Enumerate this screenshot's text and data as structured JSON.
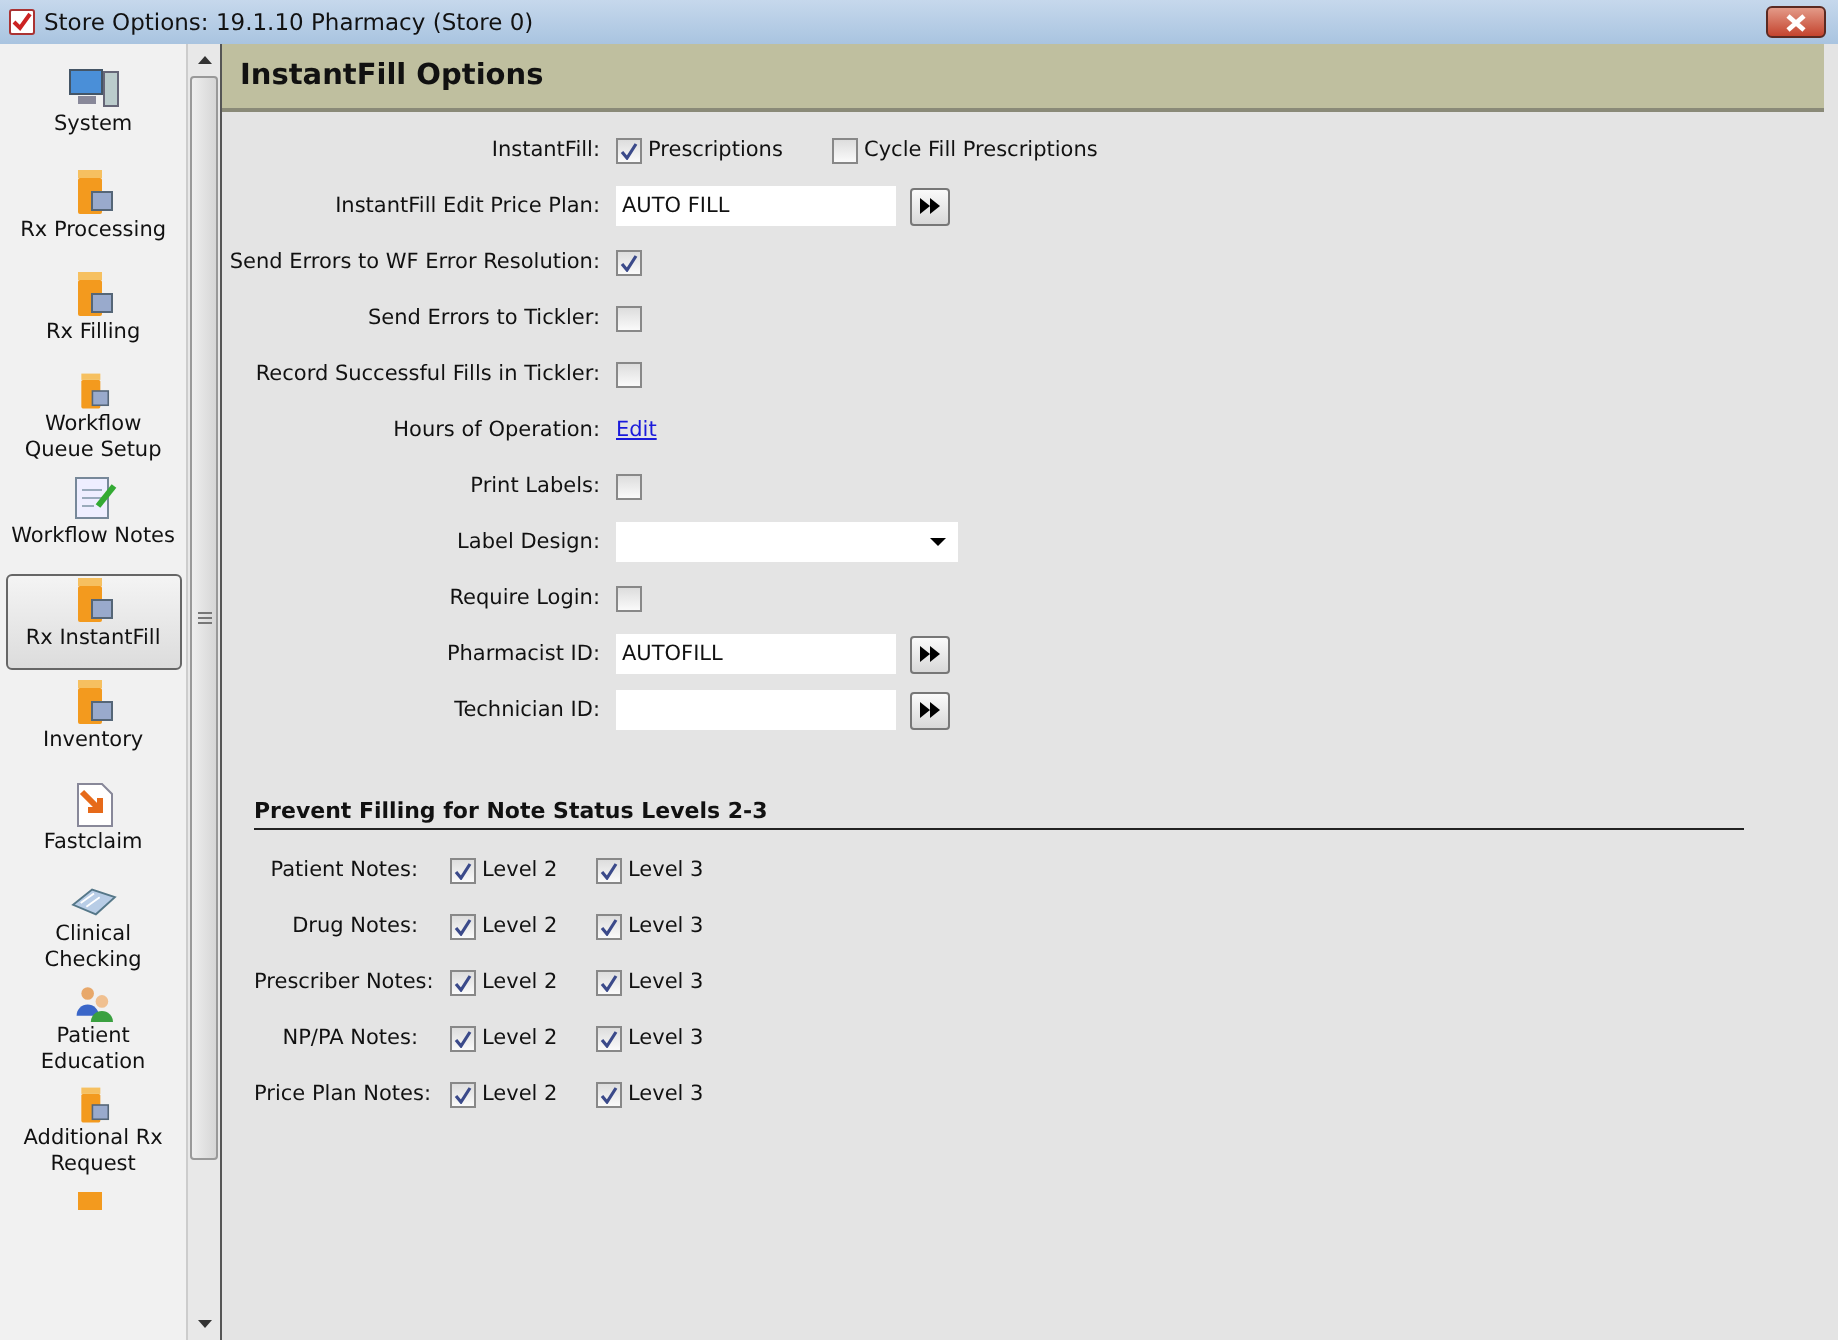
{
  "window": {
    "title": "Store Options: 19.1.10 Pharmacy (Store 0)"
  },
  "sidebar": {
    "items": [
      {
        "label": "System",
        "selected": false
      },
      {
        "label": "Rx Processing",
        "selected": false
      },
      {
        "label": "Rx Filling",
        "selected": false
      },
      {
        "label": "Workflow Queue Setup",
        "selected": false
      },
      {
        "label": "Workflow Notes",
        "selected": false
      },
      {
        "label": "Rx InstantFill",
        "selected": true
      },
      {
        "label": "Inventory",
        "selected": false
      },
      {
        "label": "Fastclaim",
        "selected": false
      },
      {
        "label": "Clinical Checking",
        "selected": false
      },
      {
        "label": "Patient Education",
        "selected": false
      },
      {
        "label": "Additional Rx Request",
        "selected": false
      }
    ]
  },
  "panel": {
    "title": "InstantFill Options",
    "rows": [
      {
        "kind": "checks",
        "label": "InstantFill:",
        "options": [
          {
            "label": "Prescriptions",
            "checked": true
          },
          {
            "label": "Cycle Fill Prescriptions",
            "checked": false
          }
        ]
      },
      {
        "kind": "lookup",
        "label": "InstantFill Edit Price Plan:",
        "value": "AUTO FILL"
      },
      {
        "kind": "checkbox",
        "label": "Send Errors to WF Error Resolution:",
        "checked": true
      },
      {
        "kind": "checkbox",
        "label": "Send Errors to Tickler:",
        "checked": false
      },
      {
        "kind": "checkbox",
        "label": "Record Successful Fills in Tickler:",
        "checked": false
      },
      {
        "kind": "link",
        "label": "Hours of Operation:",
        "link": "Edit"
      },
      {
        "kind": "checkbox",
        "label": "Print Labels:",
        "checked": false
      },
      {
        "kind": "dropdown",
        "label": "Label Design:"
      },
      {
        "kind": "checkbox",
        "label": "Require Login:",
        "checked": false
      },
      {
        "kind": "lookup",
        "label": "Pharmacist ID:",
        "value": "AUTOFILL"
      },
      {
        "kind": "lookup",
        "label": "Technician ID:"
      }
    ],
    "section": {
      "title": "Prevent Filling for Note Status Levels 2-3",
      "rows": [
        {
          "label": "Patient Notes:",
          "options": [
            {
              "label": "Level 2",
              "checked": true
            },
            {
              "label": "Level 3",
              "checked": true
            }
          ]
        },
        {
          "label": "Drug Notes:",
          "options": [
            {
              "label": "Level 2",
              "checked": true
            },
            {
              "label": "Level 3",
              "checked": true
            }
          ]
        },
        {
          "label": "Prescriber Notes:",
          "options": [
            {
              "label": "Level 2",
              "checked": true
            },
            {
              "label": "Level 3",
              "checked": true
            }
          ]
        },
        {
          "label": "NP/PA Notes:",
          "options": [
            {
              "label": "Level 2",
              "checked": true
            },
            {
              "label": "Level 3",
              "checked": true
            }
          ]
        },
        {
          "label": "Price Plan Notes:",
          "options": [
            {
              "label": "Level 2",
              "checked": true
            },
            {
              "label": "Level 3",
              "checked": true
            }
          ]
        }
      ]
    }
  }
}
